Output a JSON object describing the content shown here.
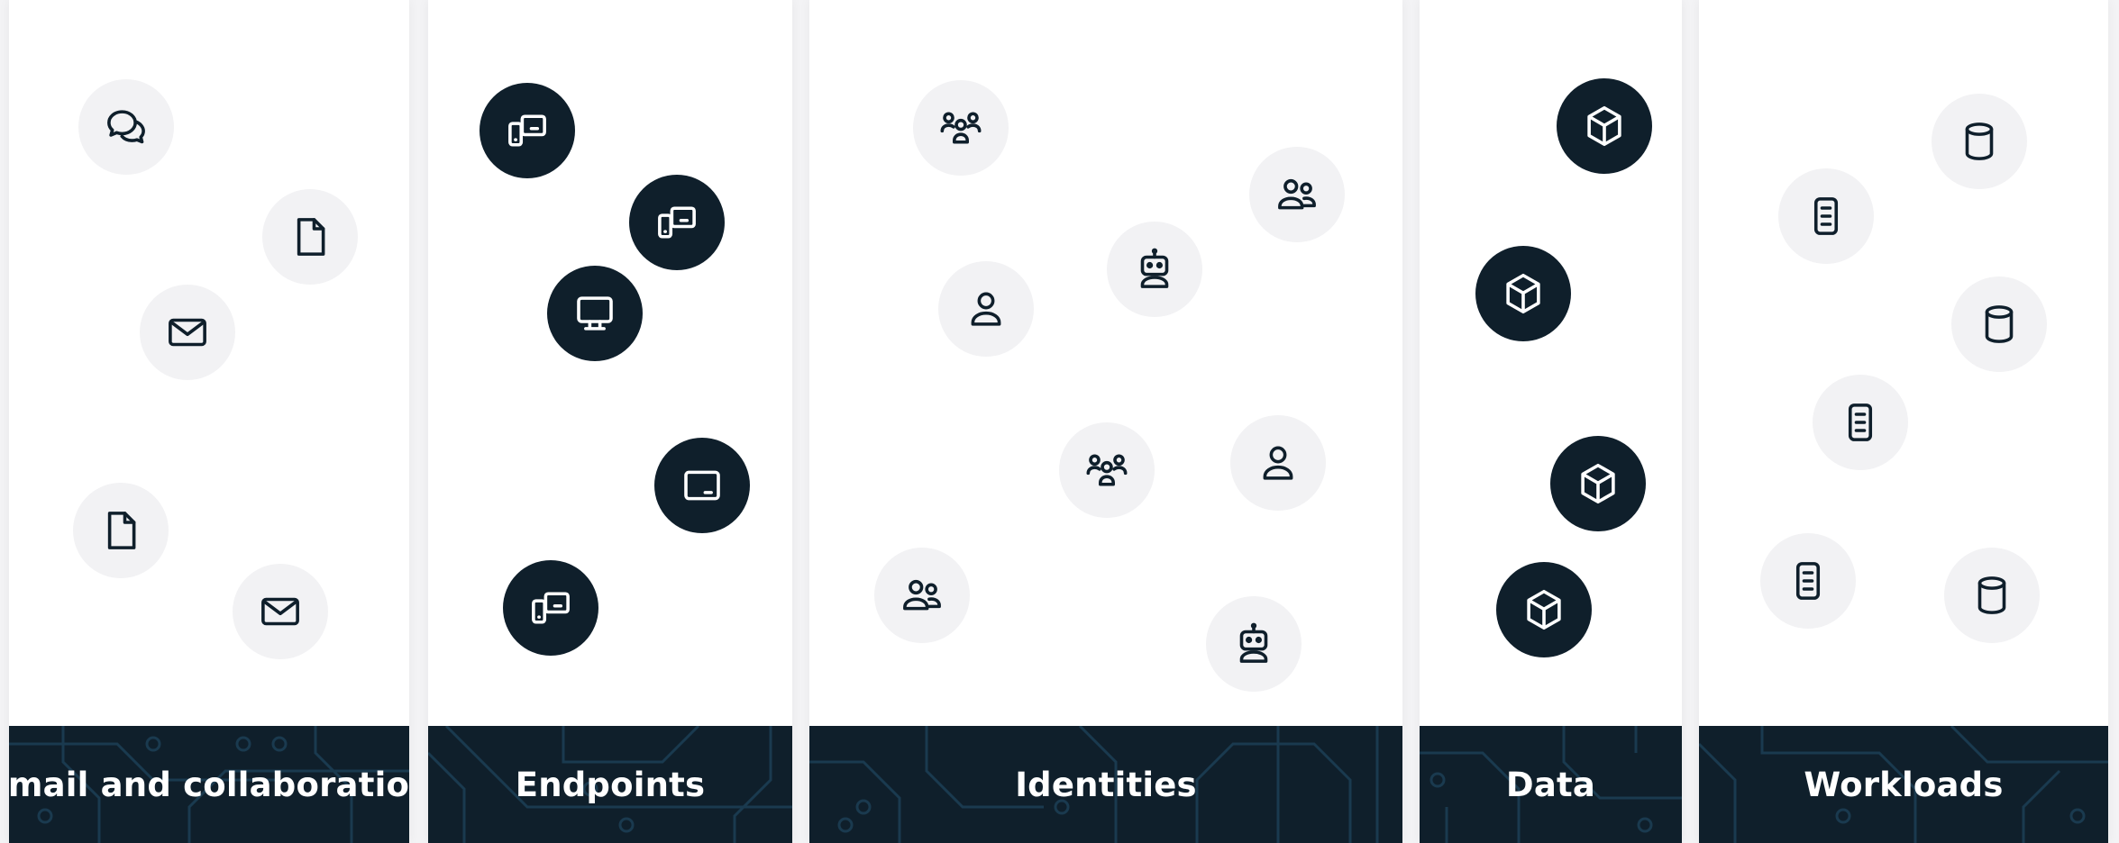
{
  "columns": [
    {
      "id": "email",
      "label": "Email and collaboration"
    },
    {
      "id": "endpoints",
      "label": "Endpoints"
    },
    {
      "id": "identities",
      "label": "Identities"
    },
    {
      "id": "data",
      "label": "Data"
    },
    {
      "id": "workloads",
      "label": "Workloads"
    }
  ],
  "icons": {
    "email": [
      "chat-icon",
      "document-icon",
      "mail-icon",
      "document-icon",
      "mail-icon"
    ],
    "endpoints": [
      "devices-icon",
      "devices-icon",
      "monitor-icon",
      "tablet-icon",
      "devices-icon"
    ],
    "identities": [
      "group-icon",
      "people-icon",
      "robot-icon",
      "user-icon",
      "group-icon",
      "user-icon",
      "people-icon",
      "robot-icon"
    ],
    "data": [
      "cube-icon",
      "cube-icon",
      "cube-icon",
      "cube-icon"
    ],
    "workloads": [
      "database-icon",
      "server-icon",
      "database-icon",
      "server-icon",
      "server-icon",
      "database-icon"
    ]
  },
  "colors": {
    "dark_navy": "#0f1f2b",
    "light_gray": "#f2f2f4",
    "background": "#f3f3f5",
    "card": "#ffffff",
    "circuit_lines": "#1a3a4f"
  }
}
